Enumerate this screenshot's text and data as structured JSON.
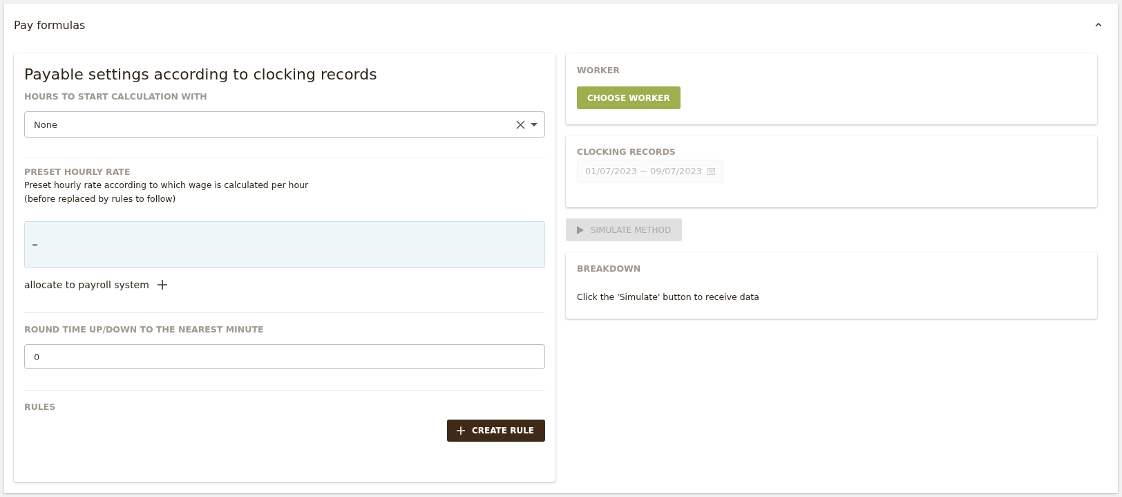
{
  "panel": {
    "title": "Pay formulas",
    "expanded": true
  },
  "settings": {
    "title": "Payable settings according to clocking records",
    "hours_start": {
      "label": "HOURS TO START CALCULATION WITH",
      "value": "None"
    },
    "hourly_rate": {
      "label": "PRESET HOURLY RATE",
      "description": "Preset hourly rate according to which wage is calculated per hour\n(before replaced by rules to follow)",
      "formula": "=",
      "allocate_label": "allocate to payroll system"
    },
    "rounding": {
      "label": "ROUND TIME UP/DOWN TO THE NEAREST MINUTE",
      "value": "0"
    },
    "rules": {
      "label": "RULES",
      "button": "CREATE RULE"
    }
  },
  "worker": {
    "label": "WORKER",
    "button": "CHOOSE WORKER"
  },
  "clocking": {
    "label": "CLOCKING RECORDS",
    "range": "01/07/2023 ~ 09/07/2023",
    "disabled": true
  },
  "simulate": {
    "label": "SIMULATE METHOD",
    "disabled": true
  },
  "breakdown": {
    "label": "BREAKDOWN",
    "message": "Click the 'Simulate' button to receive data"
  }
}
